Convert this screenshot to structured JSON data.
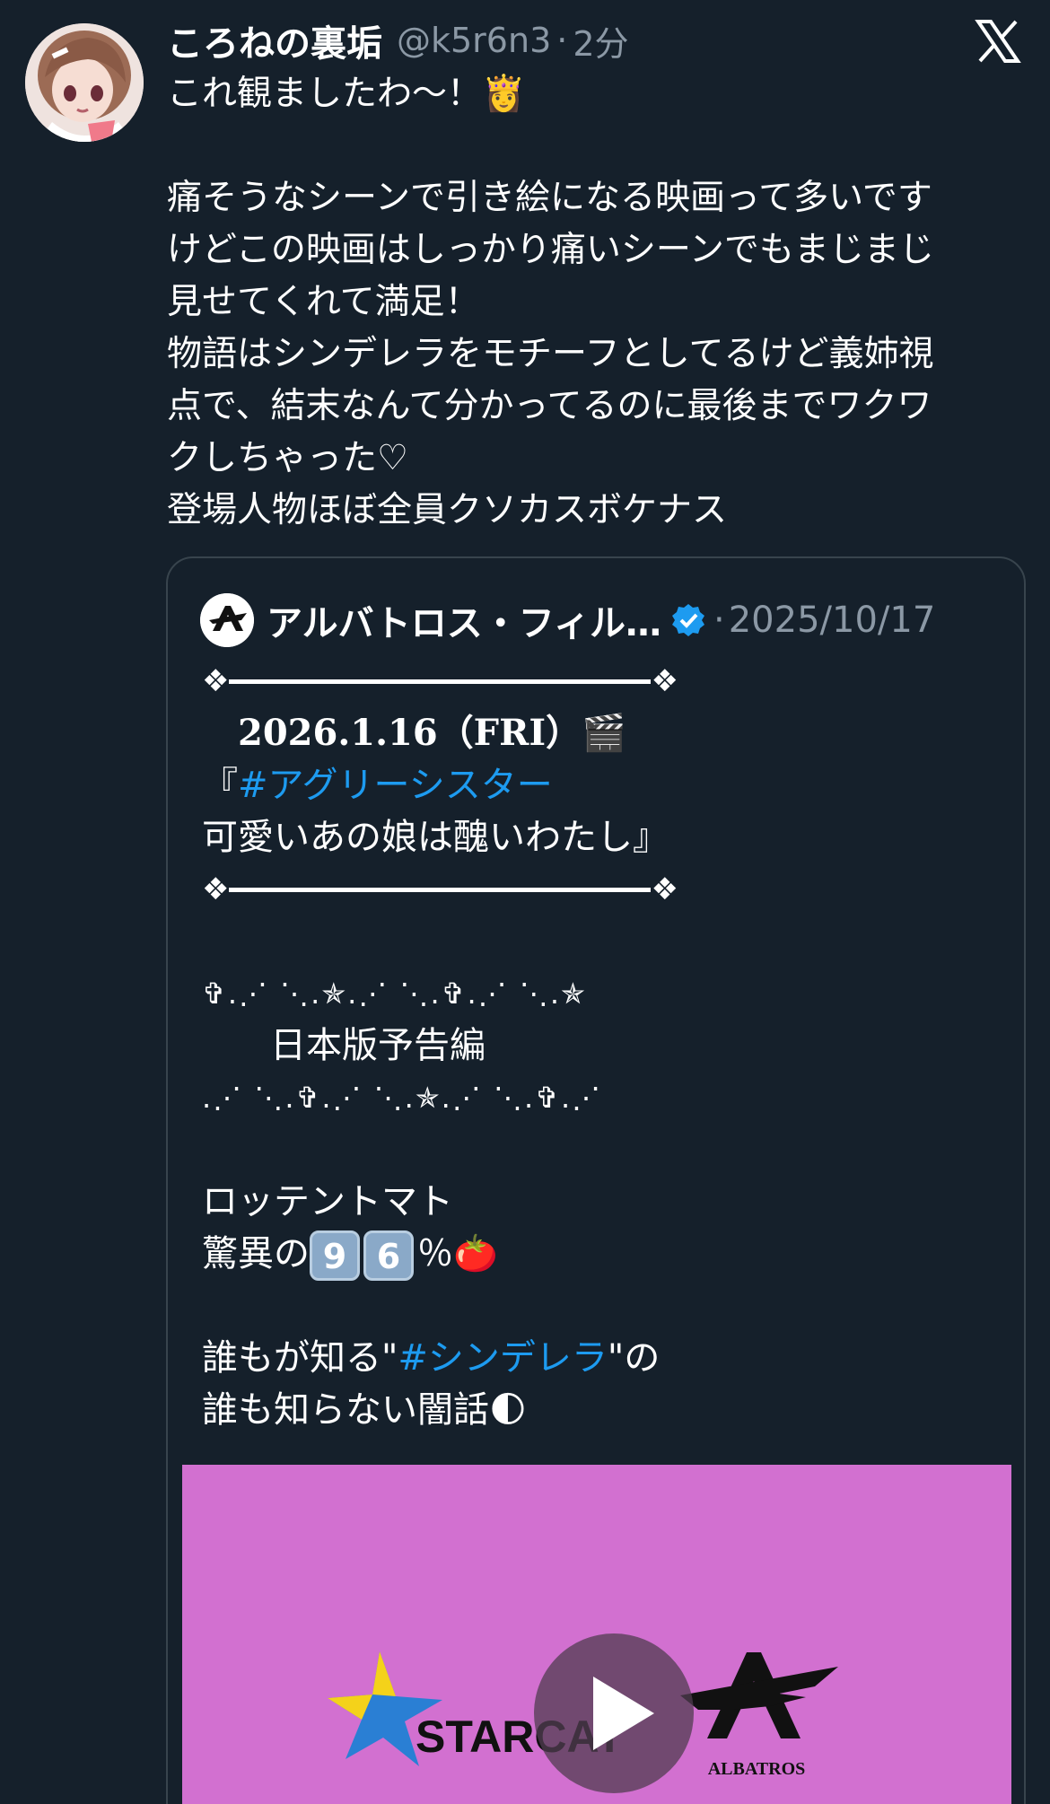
{
  "post": {
    "display_name": "ころねの裏垢",
    "handle": "@k5r6n3",
    "separator": "·",
    "time_ago": "2分",
    "text_lines": [
      "これ観ましたわ〜！👸",
      "",
      "痛そうなシーンで引き絵になる映画って多いです",
      "けどこの映画はしっかり痛いシーンでもまじまじ",
      "見せてくれて満足！",
      "物語はシンデレラをモチーフとしてるけど義姉視",
      "点で、結末なんて分かってるのに最後までワクワ",
      "クしちゃった♡",
      "登場人物ほぼ全員クソカスボケナス"
    ]
  },
  "quote": {
    "display_name": "アルバトロス・フィル…",
    "separator": "·",
    "date": "2025/10/17",
    "release_date": "2026.1.16（FRI）🎬",
    "title_open": "『",
    "hashtag_title": "#アグリーシスター",
    "title_line2": "可愛いあの娘は醜いわたし』",
    "stars_line1": "✞.⋰ ⋱.✯.⋰ ⋱.✞.⋰ ⋱.✯",
    "trailer_label": "日本版予告編",
    "stars_line2": ".⋰ ⋱.✞.⋰ ⋱.✯.⋰ ⋱.✞.⋰",
    "rotten_tomatoes": "ロッテントマト",
    "score_prefix": "驚異の",
    "score_digit1": "9",
    "score_digit2": "6",
    "score_suffix": "％🍅",
    "cinderella_prefix": "誰もが知る\"",
    "hashtag_cinderella": "#シンデレラ",
    "cinderella_suffix": "\"の",
    "dark_tale": "誰も知らない闇話🌓",
    "media": {
      "logo_starcat": "STARCAT",
      "logo_albatros": "ALBATROS",
      "background_color": "#d270d0"
    }
  },
  "colors": {
    "background": "#15202b",
    "accent": "#1d9bf0",
    "muted": "#8b98a5",
    "border": "#38444d"
  }
}
